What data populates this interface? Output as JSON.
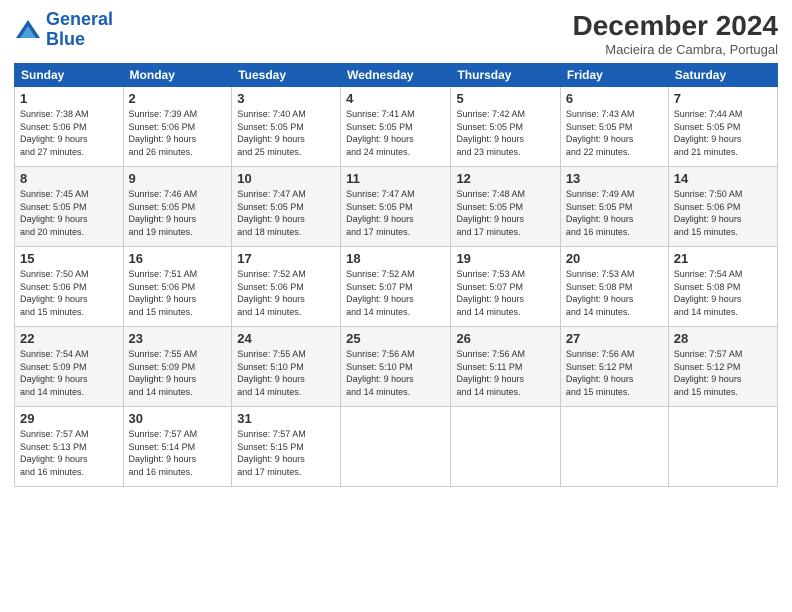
{
  "logo": {
    "line1": "General",
    "line2": "Blue"
  },
  "title": "December 2024",
  "location": "Macieira de Cambra, Portugal",
  "weekdays": [
    "Sunday",
    "Monday",
    "Tuesday",
    "Wednesday",
    "Thursday",
    "Friday",
    "Saturday"
  ],
  "weeks": [
    [
      {
        "day": "1",
        "info": "Sunrise: 7:38 AM\nSunset: 5:06 PM\nDaylight: 9 hours\nand 27 minutes."
      },
      {
        "day": "2",
        "info": "Sunrise: 7:39 AM\nSunset: 5:06 PM\nDaylight: 9 hours\nand 26 minutes."
      },
      {
        "day": "3",
        "info": "Sunrise: 7:40 AM\nSunset: 5:05 PM\nDaylight: 9 hours\nand 25 minutes."
      },
      {
        "day": "4",
        "info": "Sunrise: 7:41 AM\nSunset: 5:05 PM\nDaylight: 9 hours\nand 24 minutes."
      },
      {
        "day": "5",
        "info": "Sunrise: 7:42 AM\nSunset: 5:05 PM\nDaylight: 9 hours\nand 23 minutes."
      },
      {
        "day": "6",
        "info": "Sunrise: 7:43 AM\nSunset: 5:05 PM\nDaylight: 9 hours\nand 22 minutes."
      },
      {
        "day": "7",
        "info": "Sunrise: 7:44 AM\nSunset: 5:05 PM\nDaylight: 9 hours\nand 21 minutes."
      }
    ],
    [
      {
        "day": "8",
        "info": "Sunrise: 7:45 AM\nSunset: 5:05 PM\nDaylight: 9 hours\nand 20 minutes."
      },
      {
        "day": "9",
        "info": "Sunrise: 7:46 AM\nSunset: 5:05 PM\nDaylight: 9 hours\nand 19 minutes."
      },
      {
        "day": "10",
        "info": "Sunrise: 7:47 AM\nSunset: 5:05 PM\nDaylight: 9 hours\nand 18 minutes."
      },
      {
        "day": "11",
        "info": "Sunrise: 7:47 AM\nSunset: 5:05 PM\nDaylight: 9 hours\nand 17 minutes."
      },
      {
        "day": "12",
        "info": "Sunrise: 7:48 AM\nSunset: 5:05 PM\nDaylight: 9 hours\nand 17 minutes."
      },
      {
        "day": "13",
        "info": "Sunrise: 7:49 AM\nSunset: 5:05 PM\nDaylight: 9 hours\nand 16 minutes."
      },
      {
        "day": "14",
        "info": "Sunrise: 7:50 AM\nSunset: 5:06 PM\nDaylight: 9 hours\nand 15 minutes."
      }
    ],
    [
      {
        "day": "15",
        "info": "Sunrise: 7:50 AM\nSunset: 5:06 PM\nDaylight: 9 hours\nand 15 minutes."
      },
      {
        "day": "16",
        "info": "Sunrise: 7:51 AM\nSunset: 5:06 PM\nDaylight: 9 hours\nand 15 minutes."
      },
      {
        "day": "17",
        "info": "Sunrise: 7:52 AM\nSunset: 5:06 PM\nDaylight: 9 hours\nand 14 minutes."
      },
      {
        "day": "18",
        "info": "Sunrise: 7:52 AM\nSunset: 5:07 PM\nDaylight: 9 hours\nand 14 minutes."
      },
      {
        "day": "19",
        "info": "Sunrise: 7:53 AM\nSunset: 5:07 PM\nDaylight: 9 hours\nand 14 minutes."
      },
      {
        "day": "20",
        "info": "Sunrise: 7:53 AM\nSunset: 5:08 PM\nDaylight: 9 hours\nand 14 minutes."
      },
      {
        "day": "21",
        "info": "Sunrise: 7:54 AM\nSunset: 5:08 PM\nDaylight: 9 hours\nand 14 minutes."
      }
    ],
    [
      {
        "day": "22",
        "info": "Sunrise: 7:54 AM\nSunset: 5:09 PM\nDaylight: 9 hours\nand 14 minutes."
      },
      {
        "day": "23",
        "info": "Sunrise: 7:55 AM\nSunset: 5:09 PM\nDaylight: 9 hours\nand 14 minutes."
      },
      {
        "day": "24",
        "info": "Sunrise: 7:55 AM\nSunset: 5:10 PM\nDaylight: 9 hours\nand 14 minutes."
      },
      {
        "day": "25",
        "info": "Sunrise: 7:56 AM\nSunset: 5:10 PM\nDaylight: 9 hours\nand 14 minutes."
      },
      {
        "day": "26",
        "info": "Sunrise: 7:56 AM\nSunset: 5:11 PM\nDaylight: 9 hours\nand 14 minutes."
      },
      {
        "day": "27",
        "info": "Sunrise: 7:56 AM\nSunset: 5:12 PM\nDaylight: 9 hours\nand 15 minutes."
      },
      {
        "day": "28",
        "info": "Sunrise: 7:57 AM\nSunset: 5:12 PM\nDaylight: 9 hours\nand 15 minutes."
      }
    ],
    [
      {
        "day": "29",
        "info": "Sunrise: 7:57 AM\nSunset: 5:13 PM\nDaylight: 9 hours\nand 16 minutes."
      },
      {
        "day": "30",
        "info": "Sunrise: 7:57 AM\nSunset: 5:14 PM\nDaylight: 9 hours\nand 16 minutes."
      },
      {
        "day": "31",
        "info": "Sunrise: 7:57 AM\nSunset: 5:15 PM\nDaylight: 9 hours\nand 17 minutes."
      },
      null,
      null,
      null,
      null
    ]
  ]
}
